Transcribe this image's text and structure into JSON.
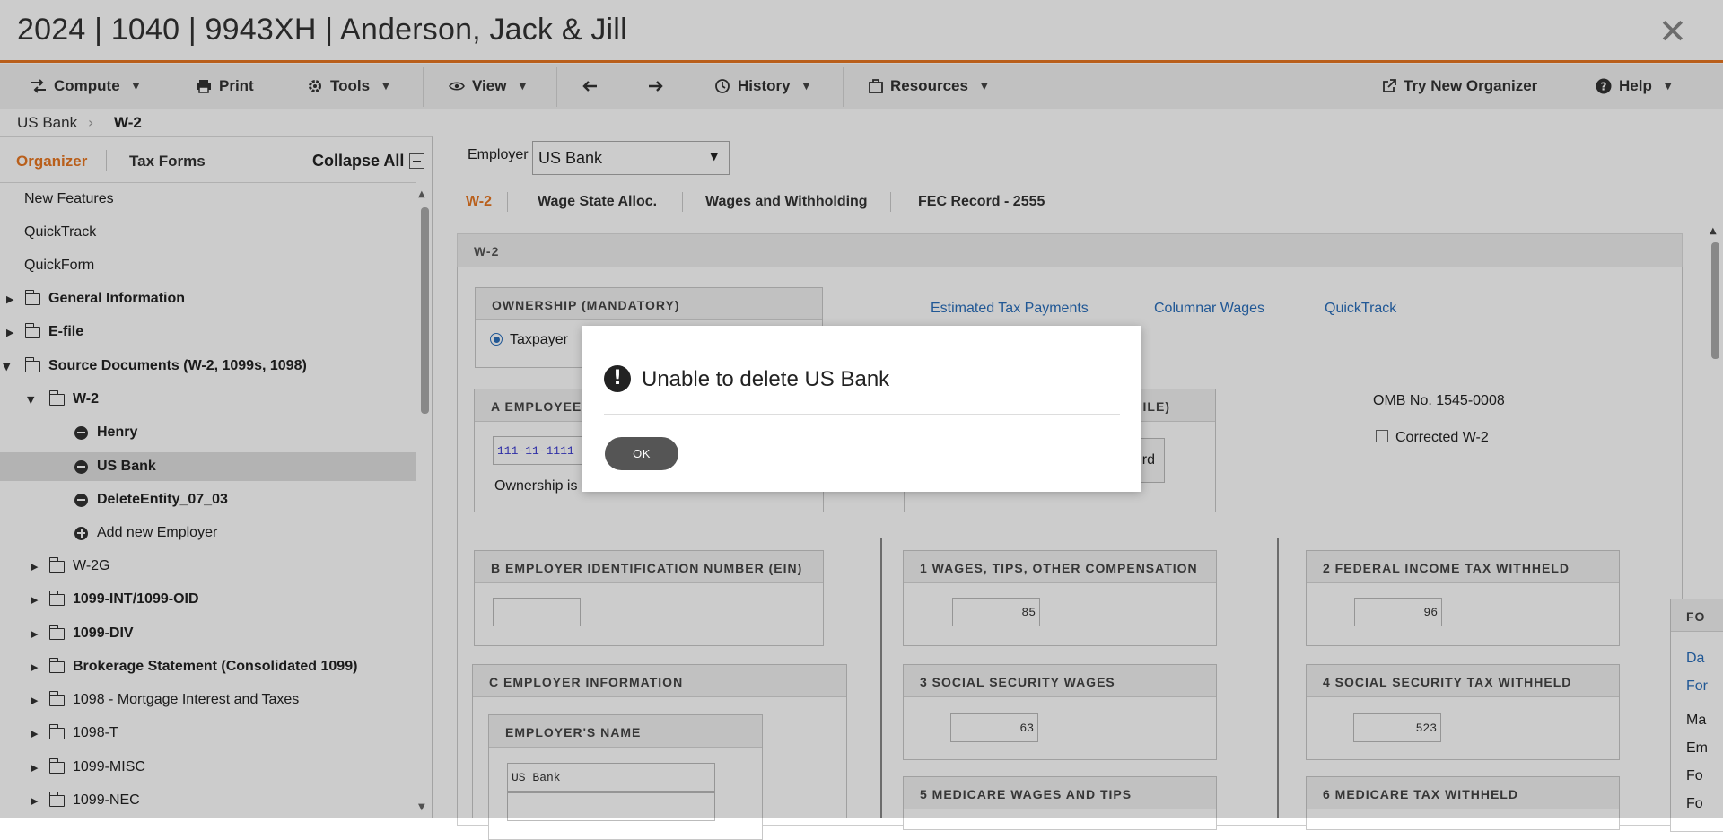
{
  "window": {
    "title": "2024 | 1040 | 9943XH | Anderson, Jack & Jill"
  },
  "toolbar": {
    "compute": "Compute",
    "print": "Print",
    "tools": "Tools",
    "view": "View",
    "history": "History",
    "resources": "Resources",
    "try_new_organizer": "Try New Organizer",
    "help": "Help"
  },
  "breadcrumb": {
    "parent": "US Bank",
    "current": "W-2"
  },
  "left_panel": {
    "tabs": {
      "organizer": "Organizer",
      "tax_forms": "Tax Forms"
    },
    "collapse_all": "Collapse All",
    "tree": [
      {
        "label": "New Features"
      },
      {
        "label": "QuickTrack"
      },
      {
        "label": "QuickForm"
      },
      {
        "label": "General Information"
      },
      {
        "label": "E-file"
      },
      {
        "label": "Source Documents (W-2, 1099s, 1098)"
      },
      {
        "label": "W-2"
      },
      {
        "label": "Henry"
      },
      {
        "label": "US Bank"
      },
      {
        "label": "DeleteEntity_07_03"
      },
      {
        "label": "Add new Employer"
      },
      {
        "label": "W-2G"
      },
      {
        "label": "1099-INT/1099-OID"
      },
      {
        "label": "1099-DIV"
      },
      {
        "label": "Brokerage Statement (Consolidated 1099)"
      },
      {
        "label": "1098 - Mortgage Interest and Taxes"
      },
      {
        "label": "1098-T"
      },
      {
        "label": "1099-MISC"
      },
      {
        "label": "1099-NEC"
      }
    ]
  },
  "main": {
    "employer_label": "Employer",
    "employer_value": "US Bank",
    "form_tabs": [
      "W-2",
      "Wage State Alloc.",
      "Wages and Withholding",
      "FEC Record - 2555"
    ],
    "section_title": "W-2",
    "ownership": {
      "title": "OWNERSHIP (MANDATORY)",
      "option": "Taxpayer"
    },
    "links": [
      "Estimated Tax Payments",
      "Columnar Wages",
      "QuickTrack"
    ],
    "box_a": {
      "title": "A EMPLOYEE",
      "ssn": "111-11-1111",
      "note": "Ownership is"
    },
    "box_a2": {
      "title_fragment": "ILE)",
      "button_fragment": "rd"
    },
    "omb": "OMB No. 1545-0008",
    "corrected": "Corrected W-2",
    "box_b": {
      "title": "B EMPLOYER IDENTIFICATION NUMBER (EIN)",
      "value": ""
    },
    "box_1": {
      "title": "1 WAGES, TIPS, OTHER COMPENSATION",
      "value": "85"
    },
    "box_2": {
      "title": "2 FEDERAL INCOME TAX WITHHELD",
      "value": "96"
    },
    "box_c": {
      "title": "C EMPLOYER INFORMATION",
      "sub_title": "EMPLOYER'S NAME",
      "name": "US Bank"
    },
    "box_3": {
      "title": "3 SOCIAL SECURITY WAGES",
      "value": "63"
    },
    "box_4": {
      "title": "4 SOCIAL SECURITY TAX WITHHELD",
      "value": "523"
    },
    "box_5": {
      "title": "5 MEDICARE WAGES AND TIPS"
    },
    "box_6": {
      "title": "6 MEDICARE TAX WITHHELD"
    },
    "side_panel": {
      "title": "FO",
      "items": [
        "Da",
        "For",
        "Ma",
        "Em",
        "Fo",
        "Fo"
      ]
    }
  },
  "dialog": {
    "message": "Unable to delete US Bank",
    "ok": "OK"
  },
  "colors": {
    "accent": "#e87722",
    "link": "#2a6ebb"
  }
}
